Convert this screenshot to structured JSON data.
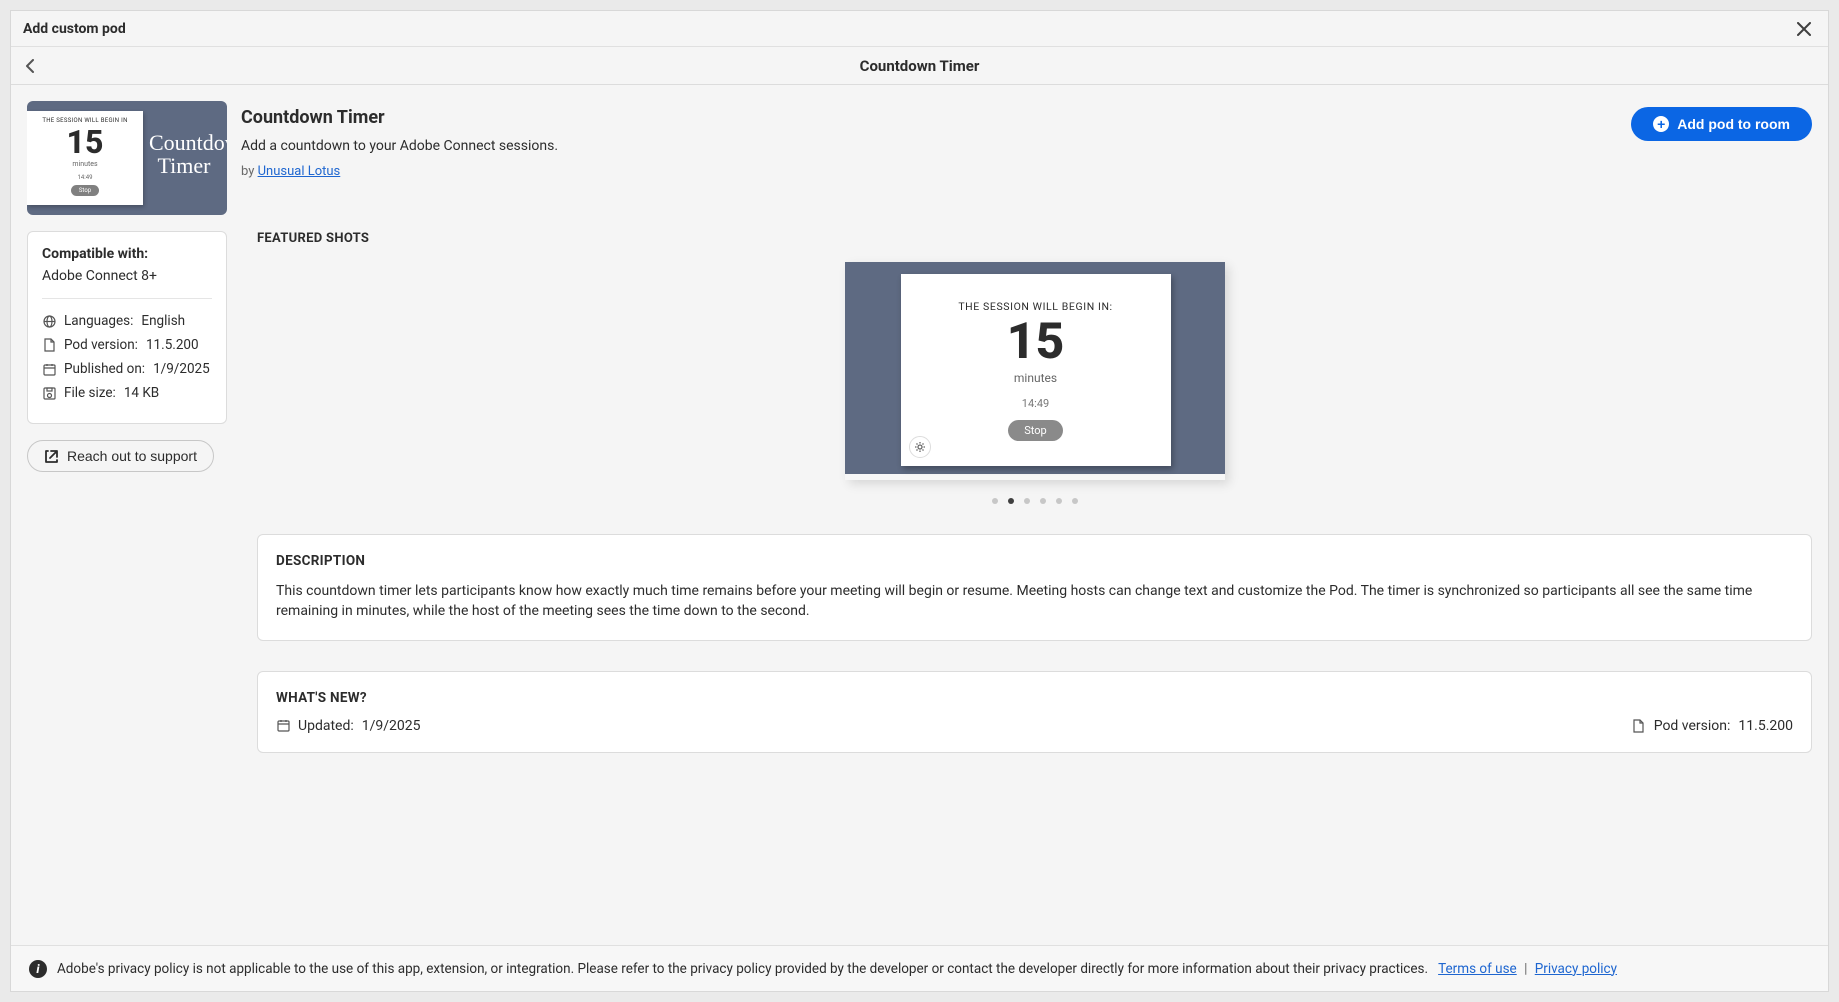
{
  "dialog_title": "Add custom pod",
  "subheader_title": "Countdown Timer",
  "pod": {
    "name": "Countdown Timer",
    "tagline": "Add a countdown to your Adobe Connect sessions.",
    "by_prefix": "by ",
    "author": "Unusual Lotus"
  },
  "add_button": "Add pod to room",
  "thumb": {
    "line1": "THE SESSION WILL BEGIN IN",
    "number": "15",
    "unit": "minutes",
    "time": "14:49",
    "stop": "Stop",
    "script": "Countdown Timer"
  },
  "compat": {
    "title": "Compatible with:",
    "value": "Adobe Connect 8+",
    "rows": [
      {
        "icon": "globe",
        "label": "Languages:",
        "value": "English"
      },
      {
        "icon": "file",
        "label": "Pod version:",
        "value": "11.5.200"
      },
      {
        "icon": "calendar",
        "label": "Published on:",
        "value": "1/9/2025"
      },
      {
        "icon": "disk",
        "label": "File size:",
        "value": "14 KB"
      }
    ]
  },
  "support_btn": "Reach out to support",
  "featured_label": "FEATURED SHOTS",
  "shot": {
    "line1": "THE SESSION WILL BEGIN IN:",
    "number": "15",
    "unit": "minutes",
    "time": "14:49",
    "stop": "Stop"
  },
  "carousel": {
    "count": 6,
    "active": 1
  },
  "description": {
    "title": "DESCRIPTION",
    "text": "This countdown timer lets participants know how exactly much time remains before your meeting will begin or resume. Meeting hosts can change text and customize the Pod. The timer is synchronized so participants all see the same time remaining in minutes, while the host of the meeting sees the time down to the second."
  },
  "whats_new": {
    "title": "WHAT'S NEW?",
    "updated_label": "Updated:",
    "updated_value": "1/9/2025",
    "version_label": "Pod version:",
    "version_value": "11.5.200"
  },
  "footer": {
    "text": "Adobe's privacy policy is not applicable to the use of this app, extension, or integration. Please refer to the privacy policy provided by the developer or contact the developer directly for more information about their privacy practices.",
    "terms": "Terms of use",
    "privacy": "Privacy policy"
  }
}
